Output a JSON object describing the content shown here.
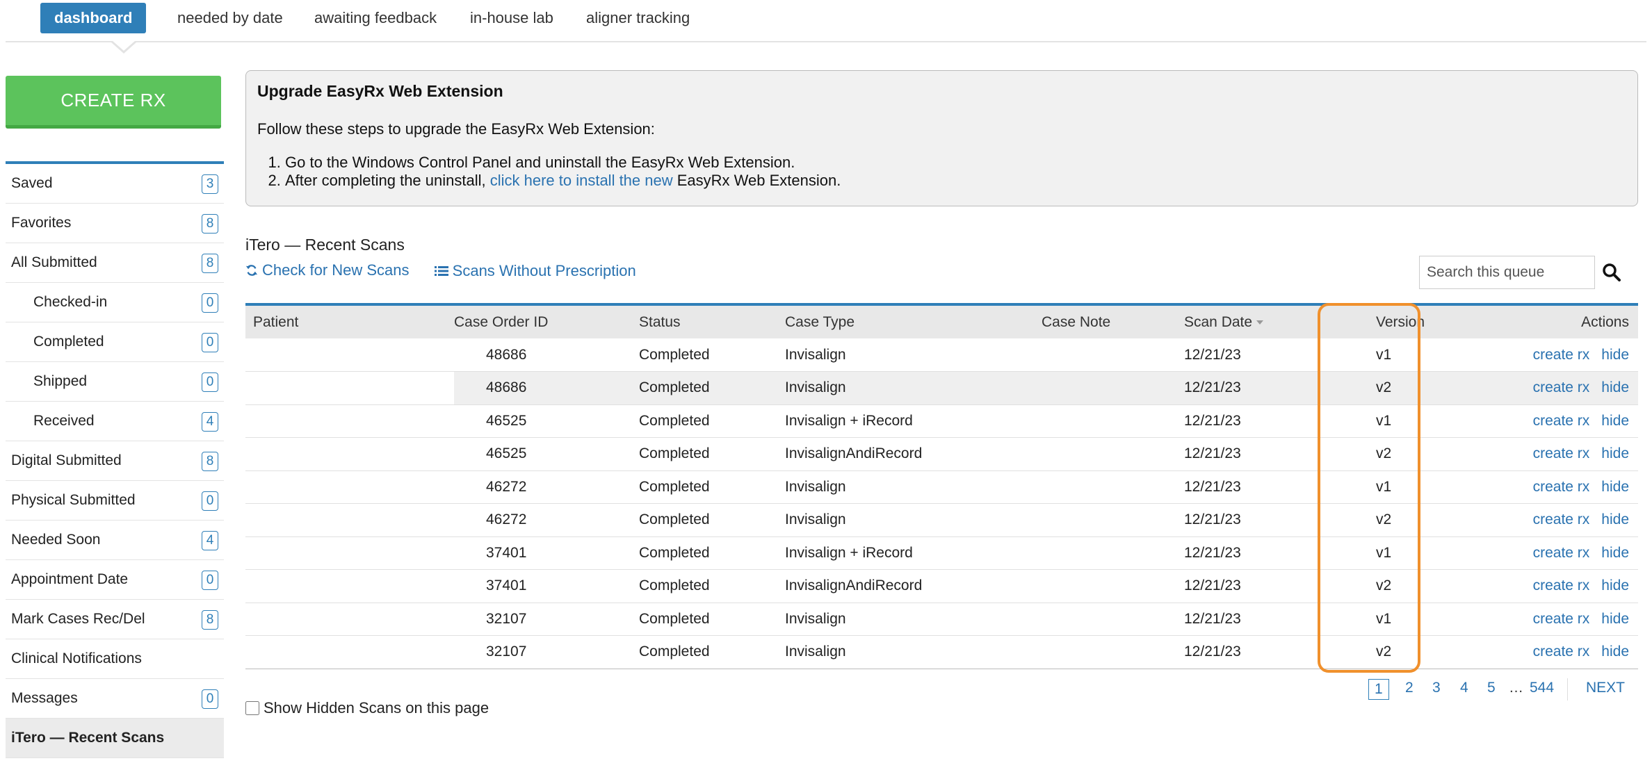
{
  "nav": {
    "tabs": [
      {
        "label": "dashboard",
        "active": true
      },
      {
        "label": "needed by date"
      },
      {
        "label": "awaiting feedback"
      },
      {
        "label": "in-house lab"
      },
      {
        "label": "aligner tracking"
      }
    ]
  },
  "create_rx_label": "CREATE RX",
  "sidebar": {
    "items": [
      {
        "label": "Saved",
        "count": "3"
      },
      {
        "label": "Favorites",
        "count": "8"
      },
      {
        "label": "All Submitted",
        "count": "8"
      },
      {
        "label": "Checked-in",
        "count": "0",
        "sub": true
      },
      {
        "label": "Completed",
        "count": "0",
        "sub": true
      },
      {
        "label": "Shipped",
        "count": "0",
        "sub": true
      },
      {
        "label": "Received",
        "count": "4",
        "sub": true
      },
      {
        "label": "Digital Submitted",
        "count": "8"
      },
      {
        "label": "Physical Submitted",
        "count": "0"
      },
      {
        "label": "Needed Soon",
        "count": "4"
      },
      {
        "label": "Appointment Date",
        "count": "0"
      },
      {
        "label": "Mark Cases Rec/Del",
        "count": "8"
      },
      {
        "label": "Clinical Notifications",
        "count": ""
      },
      {
        "label": "Messages",
        "count": "0"
      },
      {
        "label": "iTero — Recent Scans",
        "count": "",
        "active": true
      }
    ]
  },
  "notice": {
    "title": "Upgrade EasyRx Web Extension",
    "intro": "Follow these steps to upgrade the EasyRx Web Extension:",
    "step1": "Go to the Windows Control Panel and uninstall the EasyRx Web Extension.",
    "step2_before": "After completing the uninstall, ",
    "step2_link": "click here to install the new",
    "step2_after": " EasyRx Web Extension."
  },
  "section": {
    "title": "iTero — Recent Scans",
    "check_link": "Check for New Scans",
    "without_rx_link": "Scans Without Prescription",
    "search_placeholder": "Search this queue"
  },
  "table": {
    "headers": {
      "patient": "Patient",
      "case_order_id": "Case Order ID",
      "status": "Status",
      "case_type": "Case Type",
      "case_note": "Case Note",
      "scan_date": "Scan Date",
      "version": "Version",
      "actions": "Actions"
    },
    "action_create": "create rx",
    "action_hide": "hide",
    "rows": [
      {
        "id": "48686",
        "status": "Completed",
        "type": "Invisalign",
        "note": "",
        "date": "12/21/23",
        "version": "v1"
      },
      {
        "id": "48686",
        "status": "Completed",
        "type": "Invisalign",
        "note": "",
        "date": "12/21/23",
        "version": "v2"
      },
      {
        "id": "46525",
        "status": "Completed",
        "type": "Invisalign + iRecord",
        "note": "",
        "date": "12/21/23",
        "version": "v1"
      },
      {
        "id": "46525",
        "status": "Completed",
        "type": "InvisalignAndiRecord",
        "note": "",
        "date": "12/21/23",
        "version": "v2"
      },
      {
        "id": "46272",
        "status": "Completed",
        "type": "Invisalign",
        "note": "",
        "date": "12/21/23",
        "version": "v1"
      },
      {
        "id": "46272",
        "status": "Completed",
        "type": "Invisalign",
        "note": "",
        "date": "12/21/23",
        "version": "v2"
      },
      {
        "id": "37401",
        "status": "Completed",
        "type": "Invisalign + iRecord",
        "note": "",
        "date": "12/21/23",
        "version": "v1"
      },
      {
        "id": "37401",
        "status": "Completed",
        "type": "InvisalignAndiRecord",
        "note": "",
        "date": "12/21/23",
        "version": "v2"
      },
      {
        "id": "32107",
        "status": "Completed",
        "type": "Invisalign",
        "note": "",
        "date": "12/21/23",
        "version": "v1"
      },
      {
        "id": "32107",
        "status": "Completed",
        "type": "Invisalign",
        "note": "",
        "date": "12/21/23",
        "version": "v2"
      }
    ]
  },
  "footer": {
    "show_hidden_label": "Show Hidden Scans on this page",
    "pages": [
      "1",
      "2",
      "3",
      "4",
      "5"
    ],
    "ellipsis": "…",
    "last_page": "544",
    "next_label": "NEXT"
  },
  "colors": {
    "accent": "#2f7fb8",
    "create_rx": "#5cc35c",
    "link": "#2a72b0",
    "highlight": "#f0902c"
  }
}
